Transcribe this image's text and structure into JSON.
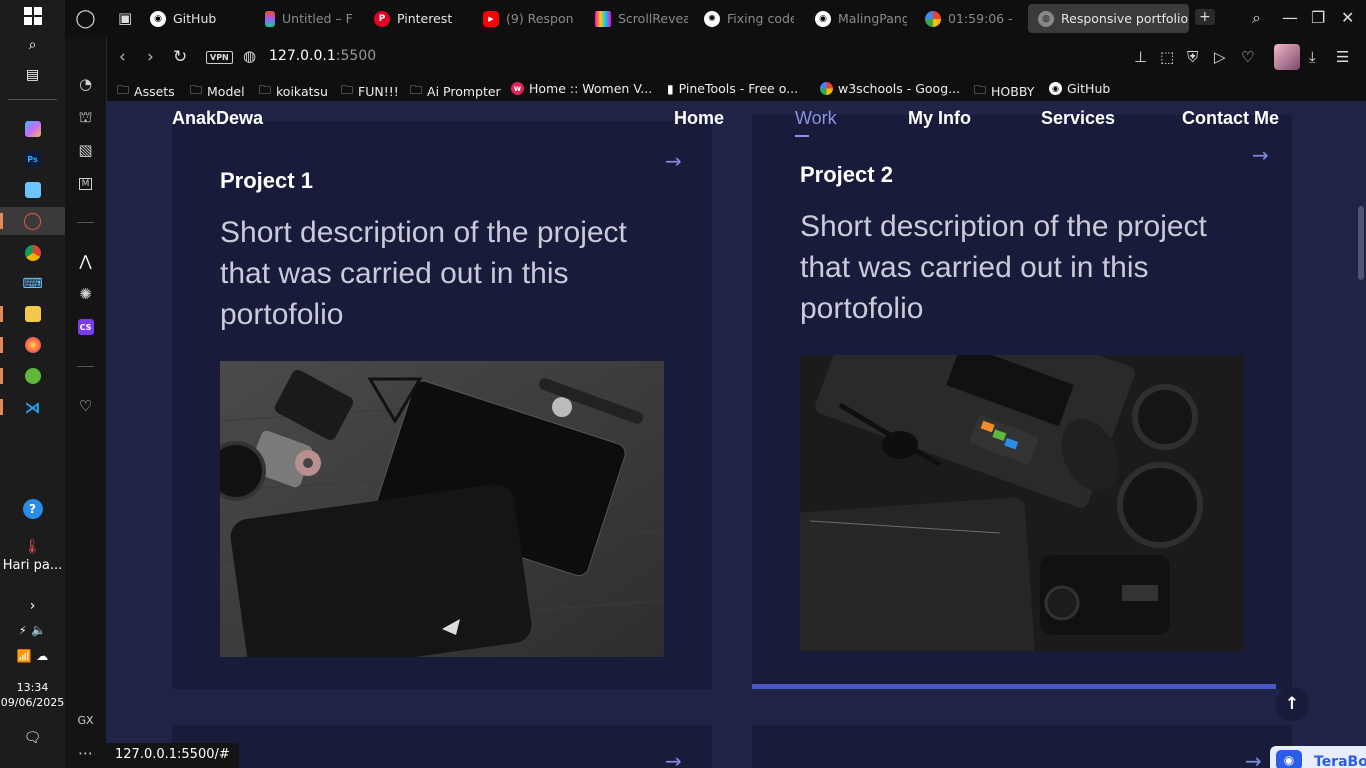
{
  "taskbar": {
    "weather_label": "Hari pa...",
    "time": "13:34",
    "date": "09/06/2025"
  },
  "sidebar": {
    "gx_label": "GX",
    "more_label": "⋯"
  },
  "tabs": [
    {
      "label": "GitHub",
      "icon": "github-icon"
    },
    {
      "label": "Untitled – F",
      "icon": "figma-icon"
    },
    {
      "label": "Pinterest",
      "icon": "pinterest-icon"
    },
    {
      "label": "(9) Respon",
      "icon": "youtube-icon"
    },
    {
      "label": "ScrollRevea",
      "icon": "scrollreveal-icon"
    },
    {
      "label": "Fixing code",
      "icon": "chatgpt-icon"
    },
    {
      "label": "MalingPang",
      "icon": "github-icon"
    },
    {
      "label": "01:59:06 - G",
      "icon": "google-icon"
    },
    {
      "label": "Responsive portfolio",
      "icon": "globe-icon",
      "active": true
    }
  ],
  "address": {
    "vpn": "VPN",
    "url_main": "127.0.0.1",
    "url_port": ":5500"
  },
  "bookmarks": [
    {
      "label": "Assets",
      "icon": "folder-icon"
    },
    {
      "label": "Model",
      "icon": "folder-icon"
    },
    {
      "label": "koikatsu",
      "icon": "folder-icon"
    },
    {
      "label": "FUN!!!",
      "icon": "folder-icon"
    },
    {
      "label": "Ai Prompter",
      "icon": "folder-icon"
    },
    {
      "label": "Home :: Women V...",
      "icon": "site-icon"
    },
    {
      "label": "PineTools - Free o...",
      "icon": "page-icon"
    },
    {
      "label": "w3schools - Goog...",
      "icon": "google-icon"
    },
    {
      "label": "HOBBY",
      "icon": "folder-icon"
    },
    {
      "label": "GitHub",
      "icon": "github-icon"
    }
  ],
  "site": {
    "brand": "AnakDewa",
    "nav": [
      "Home",
      "Work",
      "My Info",
      "Services",
      "Contact Me"
    ],
    "active_nav": "Work",
    "projects": [
      {
        "title": "Project 1",
        "description": "Short description of the project that was carried out in this portofolio"
      },
      {
        "title": "Project 2",
        "description": "Short description of the project that was carried out in this portofolio"
      }
    ]
  },
  "status_url": "127.0.0.1:5500/#",
  "terabox_label": "TeraBo",
  "colors": {
    "page_bg": "#1f2345",
    "card_bg": "#181b3a",
    "accent": "#7f89df",
    "active_bar": "#4a56c2"
  }
}
